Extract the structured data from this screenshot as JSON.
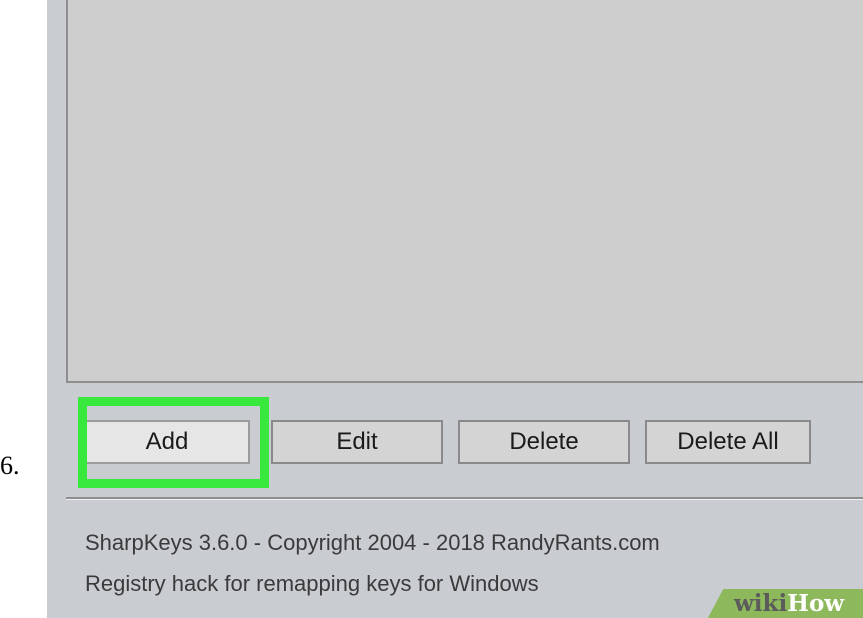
{
  "step_number": "6.",
  "buttons": {
    "add": "Add",
    "edit": "Edit",
    "delete": "Delete",
    "delete_all": "Delete All"
  },
  "status": {
    "line1": "SharpKeys 3.6.0 - Copyright 2004 - 2018 RandyRants.com",
    "line2": "Registry hack for remapping keys for Windows"
  },
  "watermark": {
    "part1": "wiki",
    "part2": "How"
  },
  "colors": {
    "highlight": "#39e83c",
    "window_background": "#c9cdd2",
    "list_background": "#cecece",
    "watermark_green": "#8db85c"
  }
}
